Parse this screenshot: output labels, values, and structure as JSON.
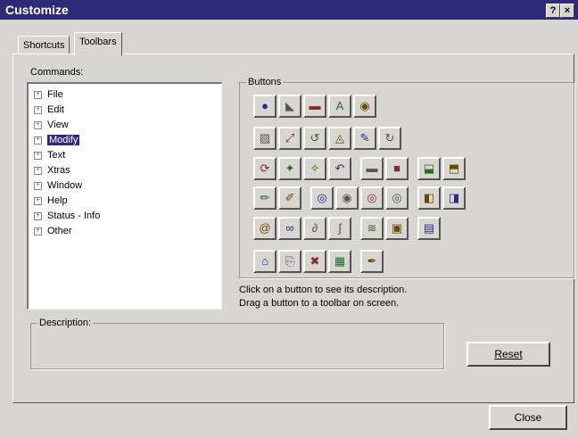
{
  "window": {
    "title": "Customize",
    "help_glyph": "?",
    "close_glyph": "×"
  },
  "tabs": [
    {
      "label": "Shortcuts"
    },
    {
      "label": "Toolbars"
    }
  ],
  "commands": {
    "label": "Commands:",
    "items": [
      {
        "label": "File"
      },
      {
        "label": "Edit"
      },
      {
        "label": "View"
      },
      {
        "label": "Modify",
        "selected": true
      },
      {
        "label": "Text"
      },
      {
        "label": "Xtras"
      },
      {
        "label": "Window"
      },
      {
        "label": "Help"
      },
      {
        "label": "Status - Info"
      },
      {
        "label": "Other"
      }
    ]
  },
  "buttons_group": {
    "title": "Buttons",
    "rows": [
      [
        "info-icon",
        "arrow-icon",
        "window-icon",
        "text-A-icon",
        "cast-icon"
      ],
      [
        "resize-icon",
        "flip-icon",
        "rotate-left-icon",
        "triangle-icon",
        "pen-icon",
        "rotate-icon"
      ],
      [
        "reshape-icon",
        "tweak-icon",
        "tweak-2-icon",
        "undo-icon",
        "line-icon",
        "fill-icon",
        "shield-icon",
        "shield-2-icon"
      ],
      [
        "pencil-icon",
        "eraser-icon",
        "ink-icon",
        "ink-2-icon",
        "ink-3-icon",
        "ink-4-icon",
        "layer-icon",
        "layer-2-icon"
      ],
      [
        "at-icon",
        "link-icon",
        "cycle-icon",
        "wave-icon",
        "stretch-icon",
        "frame-icon",
        "stack-icon"
      ],
      [
        "lock-icon",
        "paste-icon",
        "close-x-icon",
        "grid-icon",
        "brush-icon"
      ]
    ],
    "glyphs": [
      [
        "●",
        "◣",
        "▬",
        "A",
        "◉"
      ],
      [
        "▨",
        "⤢",
        "↺",
        "◬",
        "✎",
        "↻"
      ],
      [
        "⟳",
        "✦",
        "✧",
        "↶",
        "▬",
        "■",
        "⬓",
        "⬒"
      ],
      [
        "✏",
        "✐",
        "◎",
        "◉",
        "◎",
        "◎",
        "◧",
        "◨"
      ],
      [
        "@",
        "∞",
        "∂",
        "∫",
        "≋",
        "▣",
        "▤"
      ],
      [
        "⌂",
        "⎘",
        "✖",
        "▦",
        "✒"
      ]
    ],
    "hint1": "Click on a button to see its description.",
    "hint2": "Drag a button to a toolbar on screen."
  },
  "description": {
    "label": "Description:",
    "value": ""
  },
  "actions": {
    "reset": "Reset",
    "close": "Close"
  }
}
